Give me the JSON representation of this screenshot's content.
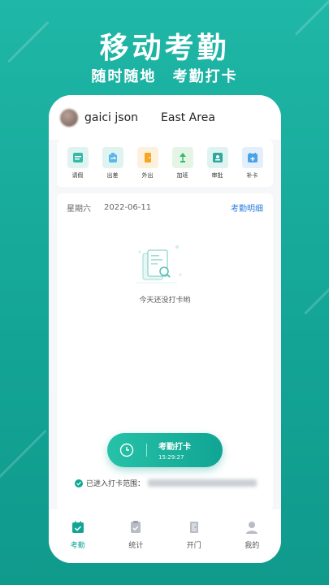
{
  "hero": {
    "title": "移动考勤",
    "sub1": "随时随地",
    "sub2": "考勤打卡"
  },
  "header": {
    "username": "gaici json",
    "area": "East Area"
  },
  "shortcuts": [
    {
      "label": "请假",
      "icon": "leave-icon"
    },
    {
      "label": "出差",
      "icon": "business-trip-icon"
    },
    {
      "label": "外出",
      "icon": "go-out-icon"
    },
    {
      "label": "加班",
      "icon": "overtime-icon"
    },
    {
      "label": "审批",
      "icon": "approval-icon"
    },
    {
      "label": "补卡",
      "icon": "makeup-card-icon"
    }
  ],
  "attendance": {
    "weekday": "星期六",
    "date": "2022-06-11",
    "detail_link": "考勤明细",
    "empty_text": "今天还没打卡哟",
    "punch_label": "考勤打卡",
    "punch_time": "15:29:27",
    "range_text": "已进入打卡范围："
  },
  "tabs": [
    {
      "label": "考勤",
      "icon": "attendance-icon",
      "active": true
    },
    {
      "label": "统计",
      "icon": "statistics-icon",
      "active": false
    },
    {
      "label": "开门",
      "icon": "door-icon",
      "active": false
    },
    {
      "label": "我的",
      "icon": "profile-icon",
      "active": false
    }
  ],
  "colors": {
    "accent": "#12a595",
    "link": "#2b7bd8",
    "background": "#1fb7a7"
  }
}
